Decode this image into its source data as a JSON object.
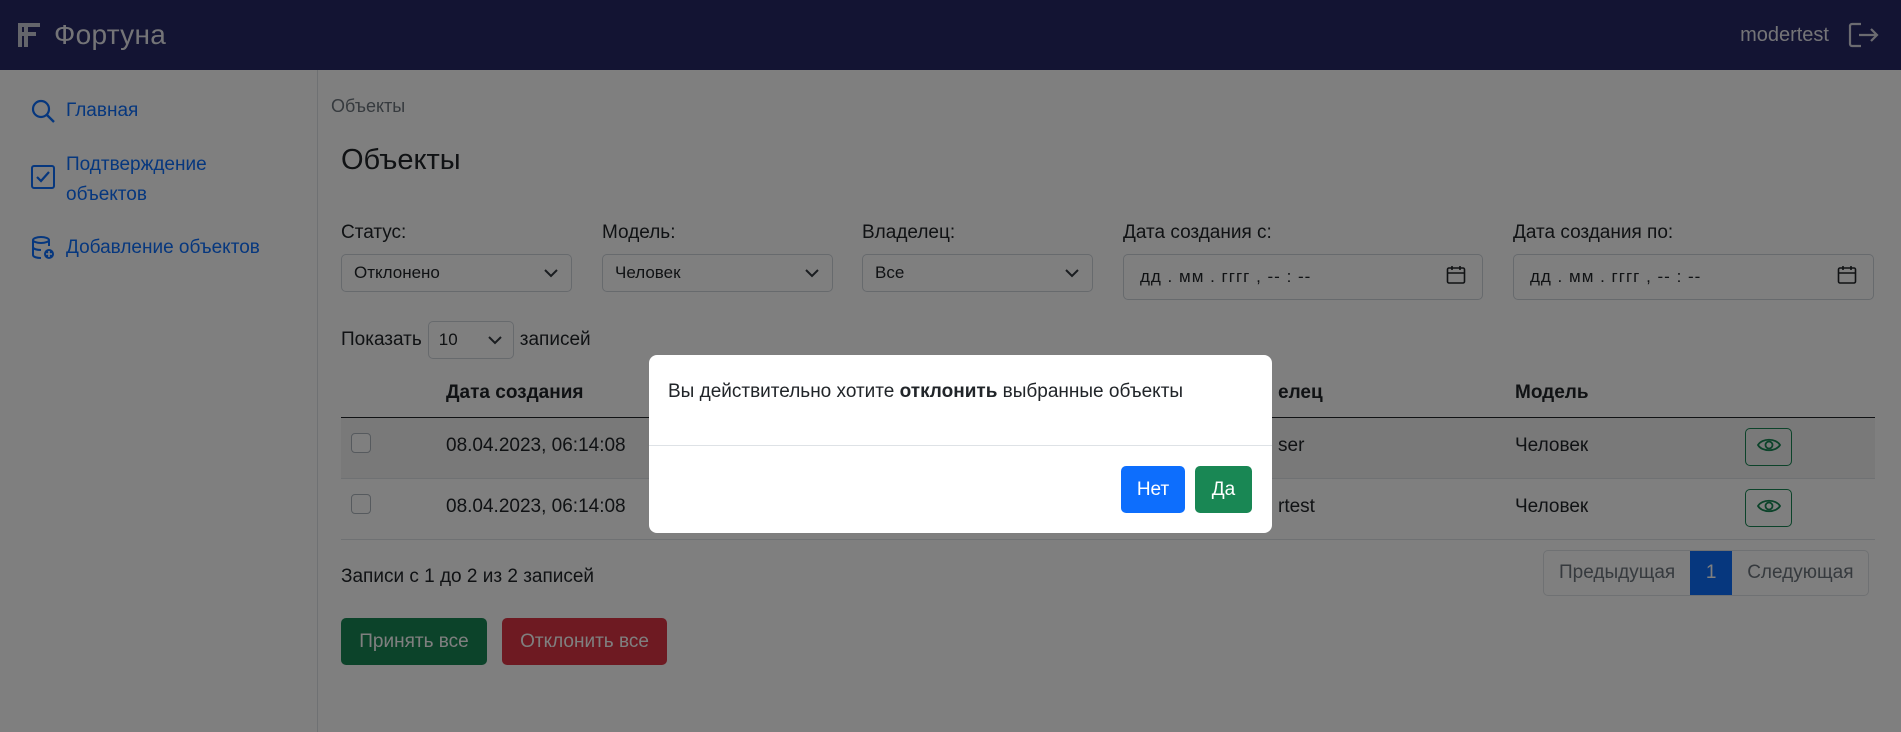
{
  "header": {
    "app_name": "Фортуна",
    "username": "modertest"
  },
  "sidebar": {
    "items": [
      {
        "label": "Главная",
        "icon": "search-icon"
      },
      {
        "label_line1": "Подтверждение",
        "label_line2": "объектов",
        "icon": "checkbox-icon"
      },
      {
        "label": "Добавление объектов",
        "icon": "database-add-icon"
      }
    ]
  },
  "breadcrumb": "Объекты",
  "page_title": "Объекты",
  "filters": {
    "status": {
      "label": "Статус:",
      "value": "Отклонено"
    },
    "model": {
      "label": "Модель:",
      "value": "Человек"
    },
    "owner": {
      "label": "Владелец:",
      "value": "Все"
    },
    "date_from": {
      "label": "Дата создания с:",
      "placeholder": "дд . мм . гггг ,  -- : --"
    },
    "date_to": {
      "label": "Дата создания по:",
      "placeholder": "дд . мм . гггг ,  -- : --"
    }
  },
  "page_size": {
    "prefix": "Показать",
    "value": "10",
    "suffix": "записей"
  },
  "table": {
    "columns": [
      "Дата создания",
      "Владелец",
      "Модель"
    ],
    "columns_visible": {
      "date": "Дата создания",
      "owner": "елец",
      "model": "Модель"
    },
    "rows": [
      {
        "date": "08.04.2023, 06:14:08",
        "owner_visible": "ser",
        "model": "Человек"
      },
      {
        "date": "08.04.2023, 06:14:08",
        "owner_visible": "rtest",
        "model": "Человек"
      }
    ]
  },
  "info_text": "Записи с 1 до 2 из 2 записей",
  "pagination": {
    "prev": "Предыдущая",
    "current": "1",
    "next": "Следующая"
  },
  "actions": {
    "accept_all": "Принять все",
    "reject_all": "Отклонить все"
  },
  "modal": {
    "text_before": "Вы действительно хотите ",
    "text_bold": "отклонить",
    "text_after": " выбранные объекты",
    "no": "Нет",
    "yes": "Да"
  },
  "colors": {
    "header_bg": "#272967",
    "primary": "#0d6efd",
    "success": "#198754",
    "danger": "#dc3545"
  }
}
